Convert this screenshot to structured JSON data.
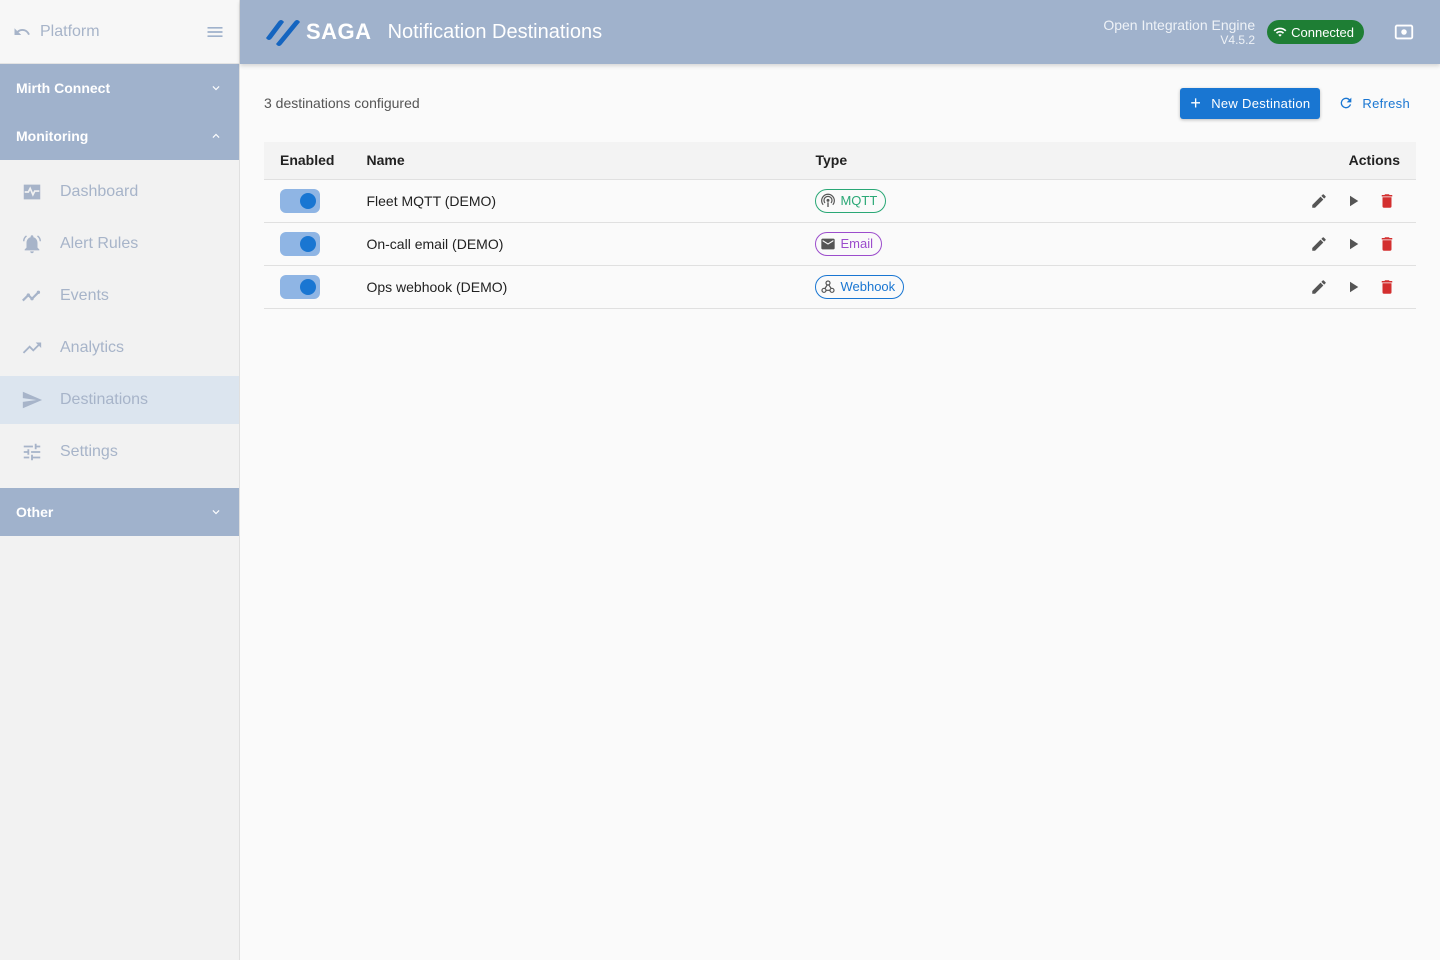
{
  "sidebar": {
    "platform_label": "Platform",
    "groups": [
      {
        "label": "Mirth Connect"
      },
      {
        "label": "Monitoring"
      },
      {
        "label": "Other"
      }
    ],
    "items": [
      {
        "label": "Dashboard",
        "icon": "monitor-heart-icon"
      },
      {
        "label": "Alert Rules",
        "icon": "alarm-bell-icon"
      },
      {
        "label": "Events",
        "icon": "timeline-icon"
      },
      {
        "label": "Analytics",
        "icon": "trending-up-icon"
      },
      {
        "label": "Destinations",
        "icon": "send-icon"
      },
      {
        "label": "Settings",
        "icon": "tune-icon"
      }
    ],
    "active_item": "Destinations"
  },
  "header": {
    "logo_text": "SAGA",
    "title": "Notification Destinations",
    "engine_name": "Open Integration Engine",
    "engine_version": "V4.5.2",
    "status": "Connected",
    "status_color": "#1e7e34"
  },
  "toolbar": {
    "count_text": "3 destinations configured",
    "new_label": "New Destination",
    "refresh_label": "Refresh"
  },
  "table": {
    "columns": [
      "Enabled",
      "Name",
      "Type",
      "Actions"
    ],
    "rows": [
      {
        "enabled": true,
        "name": "Fleet MQTT (DEMO)",
        "type": "MQTT"
      },
      {
        "enabled": true,
        "name": "On-call email (DEMO)",
        "type": "Email"
      },
      {
        "enabled": true,
        "name": "Ops webhook (DEMO)",
        "type": "Webhook"
      }
    ]
  },
  "colors": {
    "header_bg": "#a0b2cc",
    "primary": "#1976d2",
    "delete": "#d32f2f",
    "mqtt": "#2aa876",
    "email": "#9c4dcc",
    "webhook": "#1976d2"
  }
}
